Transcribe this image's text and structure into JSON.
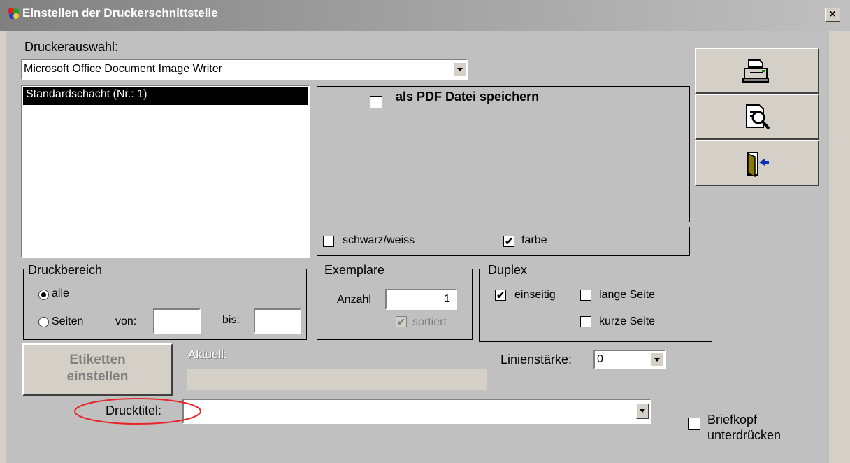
{
  "window": {
    "title": "Einstellen der Druckerschnittstelle",
    "close_label": "×"
  },
  "printer": {
    "label": "Druckerauswahl:",
    "selected": "Microsoft Office Document Image Writer",
    "trays": [
      "Standardschacht (Nr.: 1)"
    ]
  },
  "pdf": {
    "label": "als PDF Datei speichern",
    "checked": false
  },
  "color": {
    "bw_label": "schwarz/weiss",
    "bw_checked": false,
    "color_label": "farbe",
    "color_checked": true
  },
  "range": {
    "legend": "Druckbereich",
    "all_label": "alle",
    "pages_label": "Seiten",
    "from_label": "von:",
    "to_label": "bis:",
    "from_value": "",
    "to_value": ""
  },
  "copies": {
    "legend": "Exemplare",
    "count_label": "Anzahl",
    "count_value": "1",
    "sorted_label": "sortiert"
  },
  "duplex": {
    "legend": "Duplex",
    "one_side_label": "einseitig",
    "long_side_label": "lange Seite",
    "short_side_label": "kurze Seite"
  },
  "labels": {
    "button_line1": "Etiketten",
    "button_line2": "einstellen",
    "current_label": "Aktuell:",
    "current_value": ""
  },
  "line": {
    "label": "Linienstärke:",
    "value": "0"
  },
  "title_field": {
    "label": "Drucktitel:",
    "value": ""
  },
  "letterhead": {
    "label_line1": "Briefkopf",
    "label_line2": "unterdrücken"
  },
  "toolbar": {
    "print_icon": "printer-icon",
    "preview_icon": "preview-icon",
    "exit_icon": "exit-door-icon"
  },
  "colors": {
    "selection": "#000000",
    "highlight_ellipse": "#e8262a"
  }
}
